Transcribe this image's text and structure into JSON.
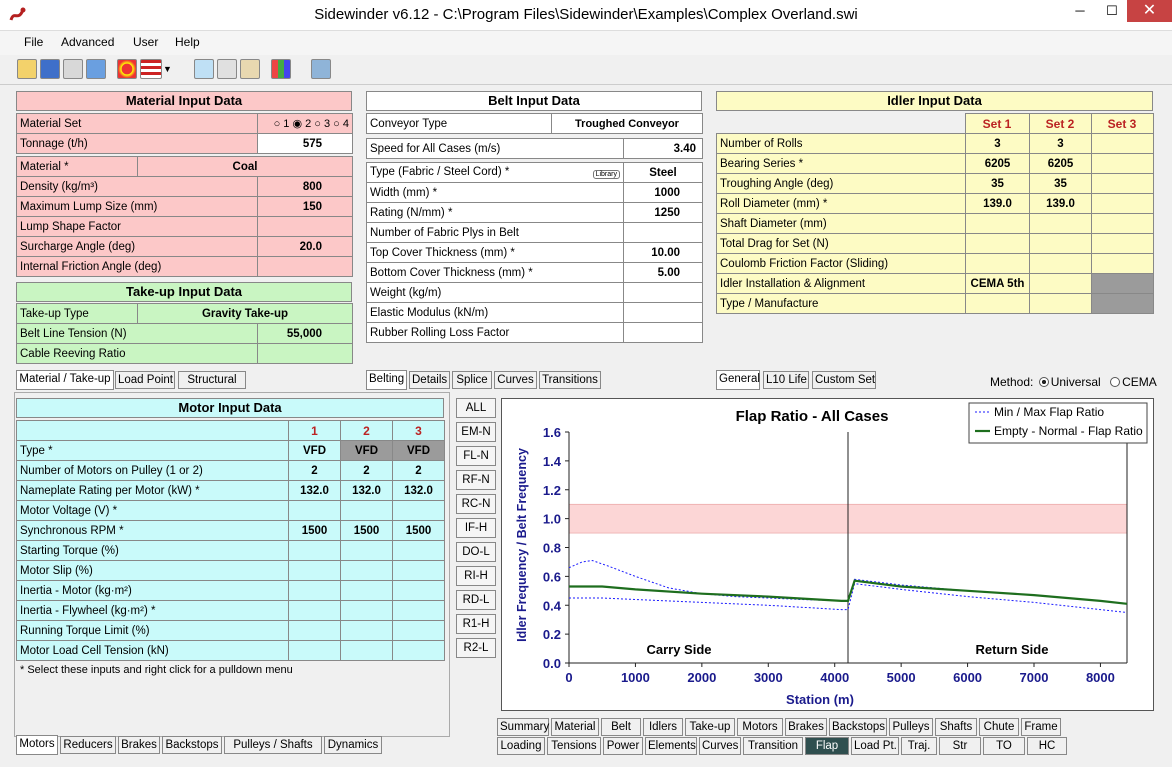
{
  "window": {
    "title": "Sidewinder v6.12 - C:\\Program Files\\Sidewinder\\Examples\\Complex Overland.swi",
    "min": "─",
    "max": "☐",
    "close": "✕"
  },
  "menu": [
    "File",
    "Advanced",
    "User",
    "Help"
  ],
  "material": {
    "title": "Material Input Data",
    "rows": [
      {
        "label": "Material Set",
        "value": "○ 1 ◉ 2 ○ 3 ○ 4"
      },
      {
        "label": "Tonnage (t/h)",
        "value": "575"
      },
      {
        "label": "Material *",
        "value": "Coal"
      },
      {
        "label": "Density (kg/m³)",
        "value": "800"
      },
      {
        "label": "Maximum Lump Size (mm)",
        "value": "150"
      },
      {
        "label": "Lump Shape Factor",
        "value": ""
      },
      {
        "label": "Surcharge Angle (deg)",
        "value": "20.0"
      },
      {
        "label": "Internal Friction Angle (deg)",
        "value": ""
      }
    ]
  },
  "takeup": {
    "title": "Take-up Input Data",
    "rows": [
      {
        "label": "Take-up Type",
        "value": "Gravity Take-up"
      },
      {
        "label": "Belt Line Tension (N)",
        "value": "55,000"
      },
      {
        "label": "Cable Reeving Ratio",
        "value": ""
      }
    ]
  },
  "left_tabs": [
    "Material / Take-up",
    "Load Point",
    "Structural"
  ],
  "belt": {
    "title": "Belt Input Data",
    "conveyor_type": {
      "label": "Conveyor Type",
      "value": "Troughed Conveyor"
    },
    "speed": {
      "label": "Speed for All Cases (m/s)",
      "value": "3.40"
    },
    "library": "Library",
    "rows": [
      {
        "label": "Type (Fabric / Steel Cord) *",
        "value": "Steel"
      },
      {
        "label": "Width (mm) *",
        "value": "1000"
      },
      {
        "label": "Rating (N/mm) *",
        "value": "1250"
      },
      {
        "label": "Number of Fabric Plys in Belt",
        "value": ""
      },
      {
        "label": "Top Cover Thickness (mm) *",
        "value": "10.00"
      },
      {
        "label": "Bottom Cover Thickness (mm) *",
        "value": "5.00"
      },
      {
        "label": "Weight (kg/m)",
        "value": ""
      },
      {
        "label": "Elastic Modulus (kN/m)",
        "value": ""
      },
      {
        "label": "Rubber Rolling Loss Factor",
        "value": ""
      }
    ]
  },
  "belt_tabs": [
    "Belting",
    "Details",
    "Splice",
    "Curves",
    "Transitions"
  ],
  "idler": {
    "title": "Idler Input Data",
    "sets": [
      "Set 1",
      "Set 2",
      "Set 3"
    ],
    "rows": [
      {
        "label": "Number of Rolls",
        "v": [
          "3",
          "3",
          ""
        ]
      },
      {
        "label": "Bearing Series *",
        "v": [
          "6205",
          "6205",
          ""
        ]
      },
      {
        "label": "Troughing Angle (deg)",
        "v": [
          "35",
          "35",
          ""
        ]
      },
      {
        "label": "Roll Diameter (mm) *",
        "v": [
          "139.0",
          "139.0",
          ""
        ]
      },
      {
        "label": "Shaft Diameter (mm)",
        "v": [
          "",
          "",
          ""
        ]
      },
      {
        "label": "Total Drag for Set (N)",
        "v": [
          "",
          "",
          ""
        ]
      },
      {
        "label": "Coulomb Friction Factor (Sliding)",
        "v": [
          "",
          "",
          ""
        ]
      },
      {
        "label": "Idler Installation & Alignment",
        "v": [
          "CEMA 5th",
          "",
          ""
        ]
      },
      {
        "label": "Type / Manufacture",
        "v": [
          "",
          "",
          ""
        ]
      }
    ]
  },
  "idler_tabs": [
    "General",
    "L10 Life",
    "Custom Set"
  ],
  "method": {
    "label": "Method:",
    "options": [
      "Universal",
      "CEMA"
    ],
    "selected": "Universal"
  },
  "motor": {
    "title": "Motor Input Data",
    "cols": [
      "1",
      "2",
      "3"
    ],
    "rows": [
      {
        "label": "Type *",
        "v": [
          "VFD",
          "VFD",
          "VFD"
        ]
      },
      {
        "label": "Number of Motors on Pulley (1 or 2)",
        "v": [
          "2",
          "2",
          "2"
        ]
      },
      {
        "label": "Nameplate Rating per Motor (kW) *",
        "v": [
          "132.0",
          "132.0",
          "132.0"
        ]
      },
      {
        "label": "Motor Voltage (V) *",
        "v": [
          "",
          "",
          ""
        ]
      },
      {
        "label": "Synchronous RPM *",
        "v": [
          "1500",
          "1500",
          "1500"
        ]
      },
      {
        "label": "Starting Torque (%)",
        "v": [
          "",
          "",
          ""
        ]
      },
      {
        "label": "Motor Slip (%)",
        "v": [
          "",
          "",
          ""
        ]
      },
      {
        "label": "Inertia - Motor (kg·m²)",
        "v": [
          "",
          "",
          ""
        ]
      },
      {
        "label": "Inertia - Flywheel (kg·m²) *",
        "v": [
          "",
          "",
          ""
        ]
      },
      {
        "label": "Running Torque Limit (%)",
        "v": [
          "",
          "",
          ""
        ]
      },
      {
        "label": "Motor Load Cell Tension (kN)",
        "v": [
          "",
          "",
          ""
        ]
      }
    ],
    "note": "* Select these inputs and right click for a pulldown menu"
  },
  "motor_tabs": [
    "Motors",
    "Reducers",
    "Brakes",
    "Backstops",
    "Pulleys / Shafts",
    "Dynamics"
  ],
  "side_buttons": [
    "ALL",
    "EM-N",
    "FL-N",
    "RF-N",
    "RC-N",
    "IF-H",
    "DO-L",
    "RI-H",
    "RD-L",
    "R1-H",
    "R2-L"
  ],
  "chart_data": {
    "type": "line",
    "title": "Flap Ratio - All Cases",
    "xlabel": "Station (m)",
    "ylabel": "Idler Frequency / Belt Frequency",
    "xlim": [
      0,
      8400
    ],
    "ylim": [
      0,
      1.6
    ],
    "xticks": [
      0,
      1000,
      2000,
      3000,
      4000,
      5000,
      6000,
      7000,
      8000
    ],
    "yticks": [
      0.0,
      0.2,
      0.4,
      0.6,
      0.8,
      1.0,
      1.2,
      1.4,
      1.6
    ],
    "band": [
      0.9,
      1.1
    ],
    "divider_x": 4200,
    "annotations": [
      "Carry Side",
      "Return Side"
    ],
    "legend": "top-right",
    "series": [
      {
        "name": "Min / Max Flap Ratio",
        "style": "dotted",
        "color": "#1a1aff",
        "upper": {
          "x": [
            0,
            200,
            350,
            600,
            1000,
            1500,
            2000,
            2500,
            3000,
            3500,
            4100,
            4200,
            4300,
            5000,
            6000,
            7000,
            8000,
            8400
          ],
          "y": [
            0.66,
            0.7,
            0.71,
            0.67,
            0.6,
            0.52,
            0.48,
            0.46,
            0.45,
            0.44,
            0.43,
            0.43,
            0.58,
            0.54,
            0.5,
            0.47,
            0.43,
            0.41
          ]
        },
        "lower": {
          "x": [
            0,
            500,
            1000,
            2000,
            3000,
            4100,
            4200,
            4300,
            5000,
            6000,
            7000,
            8000,
            8400
          ],
          "y": [
            0.45,
            0.45,
            0.44,
            0.42,
            0.4,
            0.37,
            0.37,
            0.55,
            0.51,
            0.46,
            0.42,
            0.37,
            0.35
          ]
        }
      },
      {
        "name": "Empty - Normal - Flap Ratio",
        "style": "solid",
        "color": "#1e6e1e",
        "x": [
          0,
          500,
          1000,
          2000,
          3000,
          4100,
          4200,
          4300,
          5000,
          6000,
          7000,
          8000,
          8400
        ],
        "y": [
          0.53,
          0.53,
          0.51,
          0.48,
          0.46,
          0.43,
          0.43,
          0.57,
          0.53,
          0.5,
          0.47,
          0.43,
          0.41
        ]
      }
    ]
  },
  "bottom_tabs_row1": [
    "Summary",
    "Material",
    "Belt",
    "Idlers",
    "Take-up",
    "Motors",
    "Brakes",
    "Backstops",
    "Pulleys",
    "Shafts",
    "Chute",
    "Frame"
  ],
  "bottom_tabs_row2": [
    "Loading",
    "Tensions",
    "Power",
    "Elements",
    "Curves",
    "Transition",
    "Flap",
    "Load Pt.",
    "Traj.",
    "Str",
    "TO",
    "HC"
  ]
}
